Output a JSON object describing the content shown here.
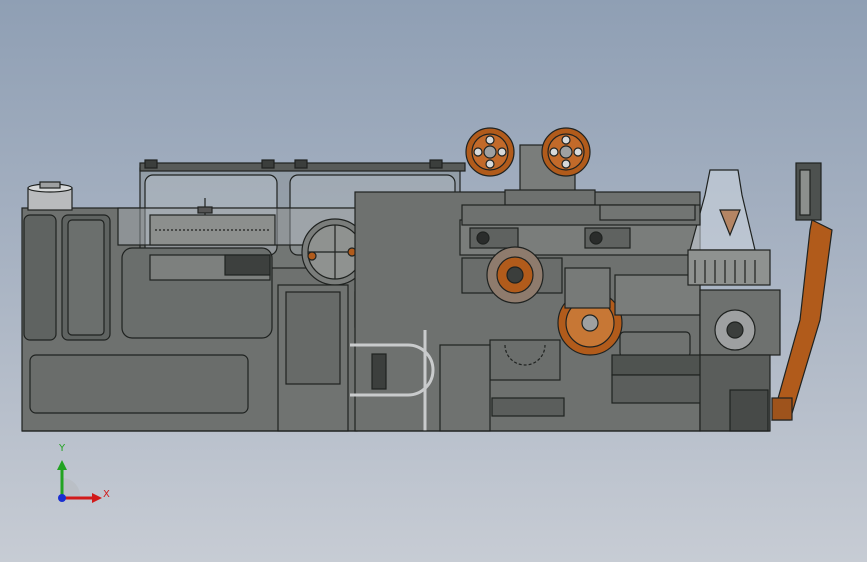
{
  "viewport": {
    "background_top": "#8f9fb4",
    "background_bottom": "#c7ccd4"
  },
  "model": {
    "body_color": "#6e716f",
    "body_dark": "#4f5350",
    "body_light": "#8a8d8b",
    "edge_color": "#1f2220",
    "accent_color": "#b15b1b",
    "glass_color": "#c9d2dc"
  },
  "triad": {
    "x_label": "X",
    "y_label": "Y",
    "x_color": "#d11a1a",
    "y_color": "#22a322",
    "z_color": "#1a2fd1"
  }
}
